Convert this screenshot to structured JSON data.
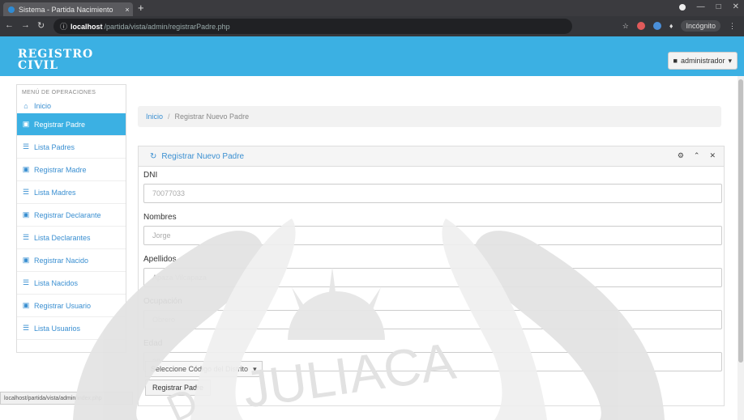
{
  "browser": {
    "tab_title": "Sistema - Partida Nacimiento",
    "tab_close": "×",
    "new_tab": "+",
    "url_host": "localhost",
    "url_path": "/partida/vista/admin/registrarPadre.php",
    "profile_label": "Incógnito"
  },
  "app": {
    "logo_line1": "Registro",
    "logo_line2": "Civil",
    "user_label": "administrador"
  },
  "sidebar": {
    "title": "MENÚ DE OPERACIONES",
    "home": "Inicio",
    "items": [
      {
        "label": "Registrar Padre",
        "icon": "form-icon",
        "active": true
      },
      {
        "label": "Lista Padres",
        "icon": "list-icon"
      },
      {
        "label": "Registrar Madre",
        "icon": "form-icon"
      },
      {
        "label": "Lista Madres",
        "icon": "list-icon"
      },
      {
        "label": "Registrar Declarante",
        "icon": "form-icon"
      },
      {
        "label": "Lista Declarantes",
        "icon": "list-icon"
      },
      {
        "label": "Registrar Nacido",
        "icon": "form-icon"
      },
      {
        "label": "Lista Nacidos",
        "icon": "list-icon"
      },
      {
        "label": "Registrar Usuario",
        "icon": "form-icon"
      },
      {
        "label": "Lista Usuarios",
        "icon": "list-icon"
      }
    ]
  },
  "breadcrumb": {
    "home": "Inicio",
    "separator": "/",
    "current": "Registrar Nuevo Padre"
  },
  "panel": {
    "title": "Registrar Nuevo Padre",
    "fields": [
      {
        "label": "DNI",
        "placeholder": "70077033"
      },
      {
        "label": "Nombres",
        "placeholder": "Jorge"
      },
      {
        "label": "Apellidos",
        "placeholder": "Apaza Vilcapaza"
      },
      {
        "label": "Ocupación",
        "placeholder": "Obrero"
      },
      {
        "label": "Edad",
        "placeholder": "38"
      }
    ],
    "select_label": "Seleccione Código del Distrito",
    "submit_label": "Registrar Padre"
  },
  "status_url": "localhost/partida/vista/admin/index.php",
  "watermark": {
    "text": "JULIACA",
    "subtext": "D"
  },
  "colors": {
    "accent": "#3bb0e3",
    "link": "#3a8fd1"
  }
}
